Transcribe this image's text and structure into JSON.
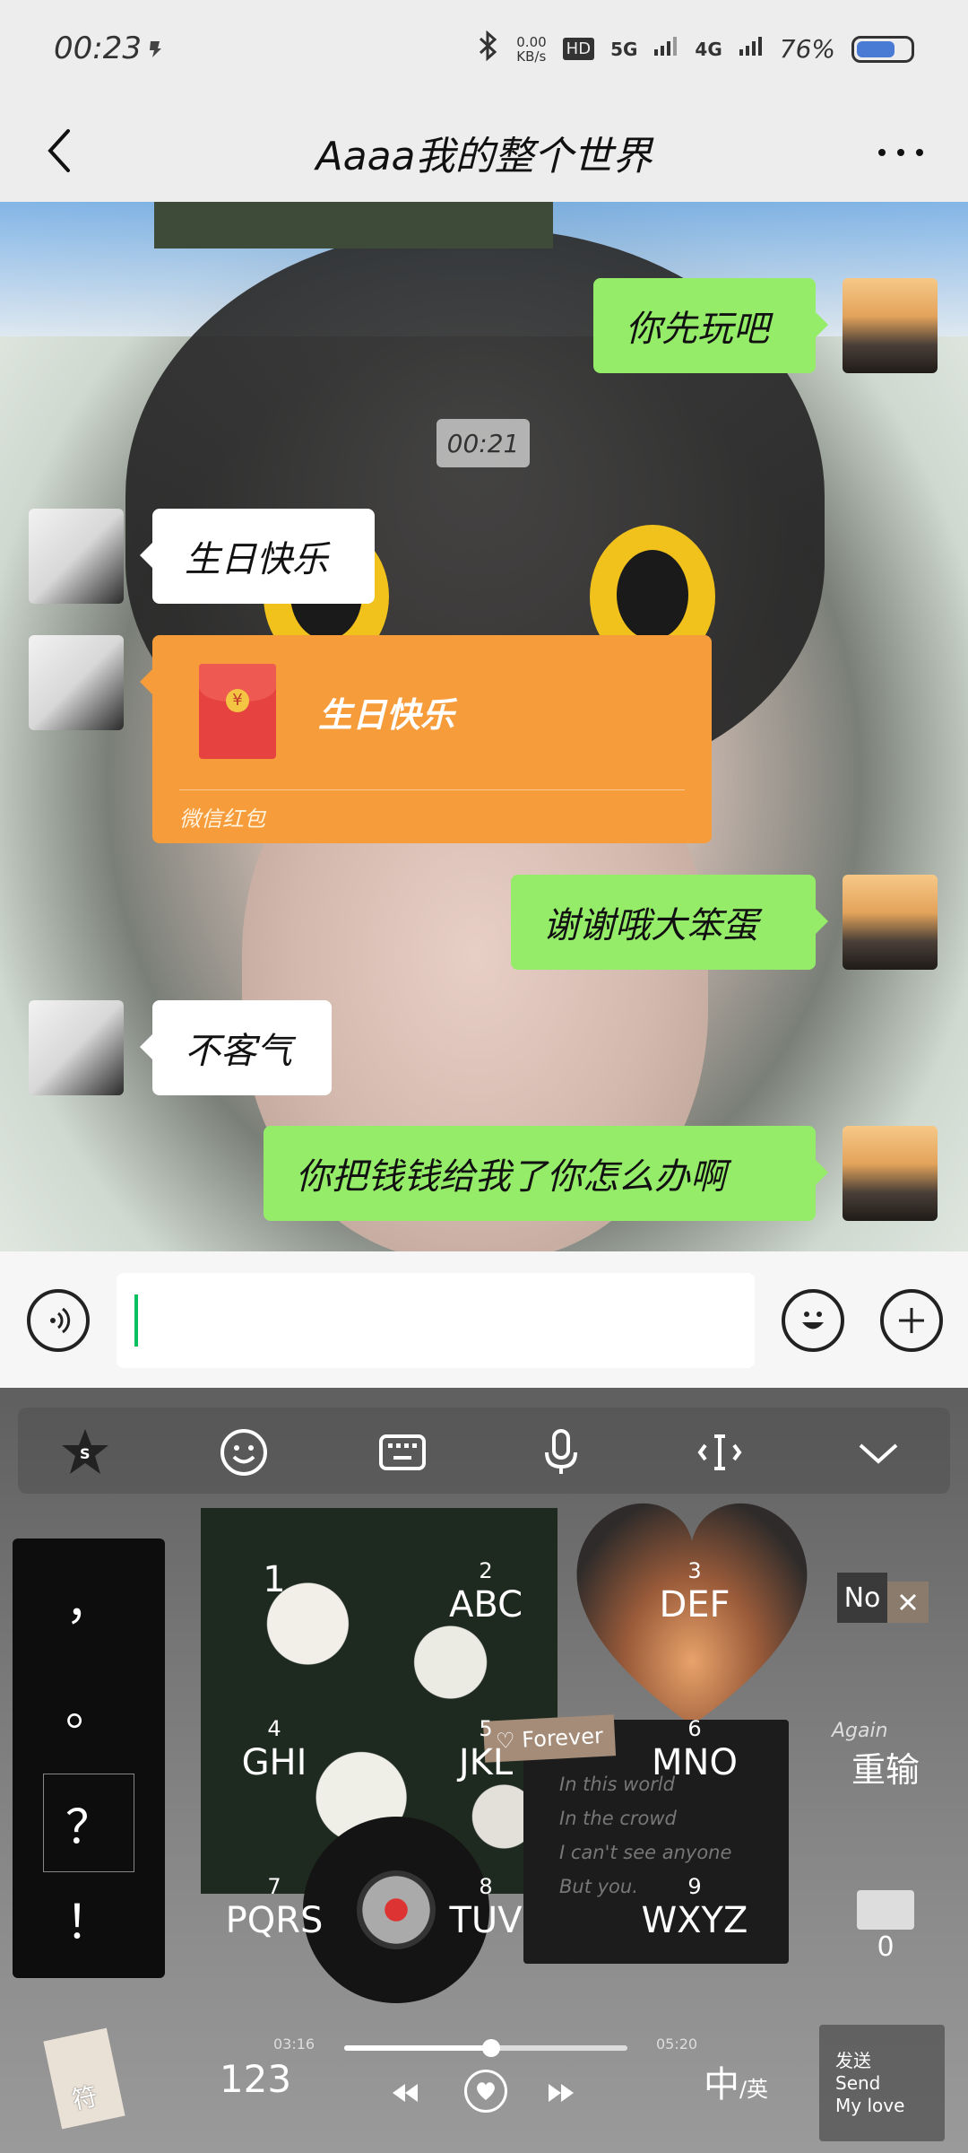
{
  "status_bar": {
    "time": "00:23",
    "net_speed_value": "0.00",
    "net_speed_unit": "KB/s",
    "signal1": "HD",
    "signal2": "5G",
    "signal3": "4G",
    "battery": "76%",
    "battery_level": 0.76
  },
  "header": {
    "title": "Aaaa我的整个世界"
  },
  "chat": {
    "timestamp": "00:21",
    "messages": [
      {
        "side": "me",
        "text": "你先玩吧"
      },
      {
        "side": "her",
        "text": "生日快乐"
      },
      {
        "side": "her",
        "type": "red_packet",
        "text": "生日快乐",
        "label": "微信红包"
      },
      {
        "side": "me",
        "text": "谢谢哦大笨蛋"
      },
      {
        "side": "her",
        "text": "不客气"
      },
      {
        "side": "me",
        "text": "你把钱钱给我了你怎么办啊"
      }
    ]
  },
  "input": {
    "value": ""
  },
  "keyboard": {
    "punctuation": [
      "，",
      "。",
      "？",
      "！"
    ],
    "keys": [
      {
        "num": "1",
        "letters": ""
      },
      {
        "num": "2",
        "letters": "ABC"
      },
      {
        "num": "3",
        "letters": "DEF"
      },
      {
        "num": "4",
        "letters": "GHI"
      },
      {
        "num": "5",
        "letters": "JKL"
      },
      {
        "num": "6",
        "letters": "MNO"
      },
      {
        "num": "7",
        "letters": "PQRS"
      },
      {
        "num": "8",
        "letters": "TUV"
      },
      {
        "num": "9",
        "letters": "WXYZ"
      }
    ],
    "card_lines": [
      "In this world",
      "In the crowd",
      "I can't see anyone",
      "But you."
    ],
    "forever_tag": "♡ Forever",
    "no_tag": "No",
    "again_label": "Again",
    "retype_label": "重输",
    "zero_key": "0",
    "symbols_key": "符",
    "num_key": "123",
    "lang_key_main": "中",
    "lang_key_sub": "/英",
    "music": {
      "elapsed": "03:16",
      "duration": "05:20",
      "progress": 0.52
    },
    "send": {
      "line1": "发送",
      "line2": "Send",
      "line3": "My love"
    }
  }
}
